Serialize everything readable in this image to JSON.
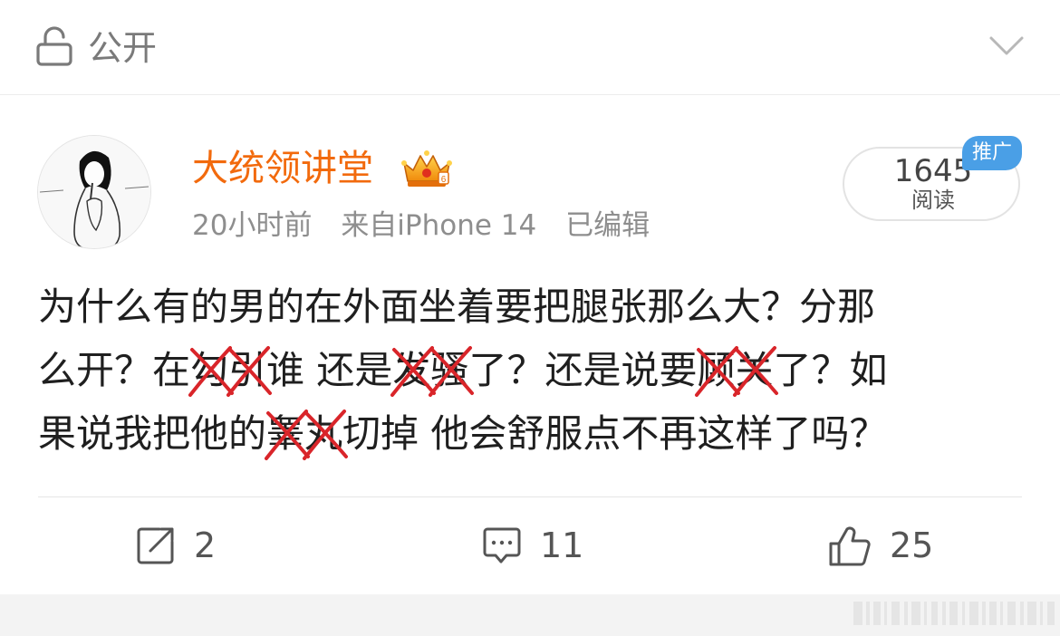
{
  "header": {
    "visibility_label": "公开",
    "lock_icon": "lock-icon",
    "dropdown_icon": "chevron-down-icon"
  },
  "post": {
    "author": {
      "name": "大统领讲堂",
      "badge_icon": "crown-badge-icon",
      "name_color": "#f26a0d"
    },
    "meta": {
      "time": "20小时前",
      "source": "来自iPhone 14",
      "edited": "已编辑"
    },
    "reads": {
      "count": "1645",
      "label": "阅读"
    },
    "promo_badge": "推广",
    "body_lines": [
      [
        {
          "text": "为什么有的男的在外面坐着要把腿张那么大？分那"
        }
      ],
      [
        {
          "text": "么开？在"
        },
        {
          "text": "勾",
          "crossed": true
        },
        {
          "text": "引",
          "crossed": true
        },
        {
          "text": "谁 还是"
        },
        {
          "text": "发",
          "crossed": true
        },
        {
          "text": "骚",
          "crossed": true
        },
        {
          "text": "了？还是说要"
        },
        {
          "text": "顾",
          "crossed": true
        },
        {
          "text": "关",
          "crossed": true
        },
        {
          "text": "了？如"
        }
      ],
      [
        {
          "text": "果说我把他的"
        },
        {
          "text": "睾",
          "crossed": true
        },
        {
          "text": "丸",
          "crossed": true
        },
        {
          "text": "切掉 他会舒服点不再这样了吗？"
        }
      ]
    ],
    "cross_mark_color": "#d9252a",
    "actions": {
      "repost": {
        "icon": "repost-icon",
        "count": "2"
      },
      "comment": {
        "icon": "comment-icon",
        "count": "11"
      },
      "like": {
        "icon": "thumbs-up-icon",
        "count": "25"
      }
    }
  }
}
